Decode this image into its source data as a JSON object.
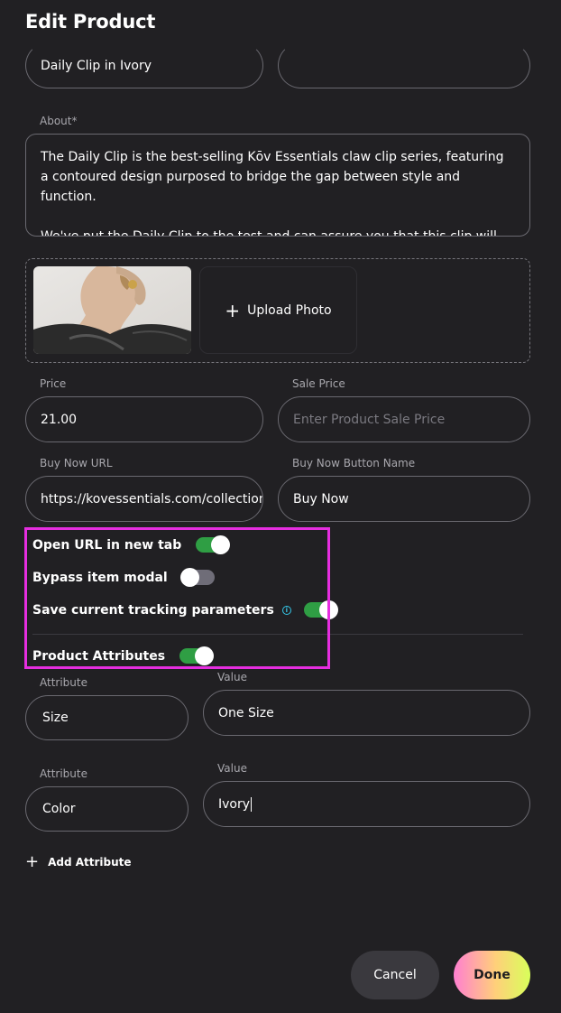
{
  "header": {
    "title": "Edit Product"
  },
  "form": {
    "name_value": "Daily Clip in Ivory",
    "about_label": "About*",
    "about_paragraphs": [
      "The Daily Clip is the best-selling Kōv Essentials claw clip series, featuring a contoured design purposed to bridge the gap between style and function.",
      "We've put the Daily Clip to the test and can assure you that this clip will hold up both literally and figuratively. Garnering millions of views on TikTok"
    ],
    "upload_label": "Upload Photo",
    "price_label": "Price",
    "price_value": "21.00",
    "sale_price_label": "Sale Price",
    "sale_price_placeholder": "Enter Product Sale Price",
    "buy_now_url_label": "Buy Now URL",
    "buy_now_url_value": "https://kovessentials.com/collections/",
    "buy_now_button_label": "Buy Now Button Name",
    "buy_now_button_value": "Buy Now"
  },
  "toggles": {
    "open_new_tab": {
      "label": "Open URL in new tab",
      "on": true
    },
    "bypass_modal": {
      "label": "Bypass item modal",
      "on": false
    },
    "save_tracking": {
      "label": "Save current tracking parameters",
      "on": true
    },
    "product_attributes": {
      "label": "Product Attributes",
      "on": true
    }
  },
  "attributes": [
    {
      "attr_label": "Attribute",
      "attr_value": "Size",
      "value_label": "Value",
      "value": "One Size"
    },
    {
      "attr_label": "Attribute",
      "attr_value": "Color",
      "value_label": "Value",
      "value": "Ivory"
    }
  ],
  "actions": {
    "add_attribute": "Add Attribute",
    "cancel": "Cancel",
    "done": "Done"
  },
  "colors": {
    "background": "#212023",
    "toggle_on": "#2f9e44",
    "highlight": "#e62ee0",
    "info_icon": "#35c6e8"
  },
  "icons": {
    "info": "i"
  }
}
